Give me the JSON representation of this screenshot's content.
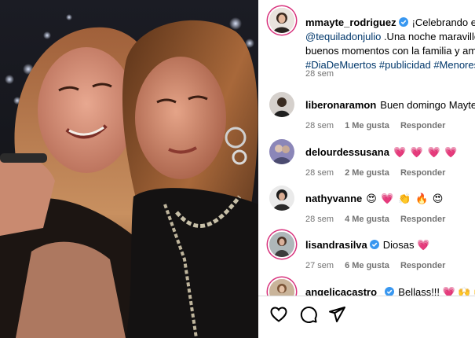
{
  "post": {
    "author": "mmayte_rodriguez",
    "caption_line1": "¡Celebrando el D",
    "caption_line2_mention": "@tequiladonjulio",
    "caption_line2_rest": " .Una noche maravillo",
    "caption_line3": "buenos momentos con la familia y ami",
    "caption_line4": "#DiaDeMuertos #publicidad #Menores",
    "time": "28 sem"
  },
  "comments": [
    {
      "user": "liberonaramon",
      "text": "Buen domingo Mayte",
      "time": "28 sem",
      "likes": "1 Me gusta",
      "reply": "Responder",
      "verified": false,
      "ring": false,
      "avatar_color": "#3a2c22"
    },
    {
      "user": "delourdessusana",
      "text": "💗 💗 💗 💗",
      "time": "28 sem",
      "likes": "2 Me gusta",
      "reply": "Responder",
      "verified": false,
      "ring": false,
      "avatar_color": "#6f6fa0"
    },
    {
      "user": "nathyvanne",
      "text": "😍 💗 👏 🔥 😍",
      "time": "28 sem",
      "likes": "4 Me gusta",
      "reply": "Responder",
      "verified": false,
      "ring": false,
      "avatar_color": "#2a2a2a"
    },
    {
      "user": "lisandrasilva",
      "text": "Diosas 💗",
      "time": "27 sem",
      "likes": "6 Me gusta",
      "reply": "Responder",
      "verified": true,
      "ring": true,
      "avatar_color": "#9aa3a6"
    },
    {
      "user": "angelicacastro_",
      "text": "Bellass!!! 💗 🙌 🙌 💗",
      "time": "",
      "likes": "",
      "reply": "",
      "verified": true,
      "ring": true,
      "avatar_color": "#b89a7a"
    }
  ],
  "actions": {
    "like": "heart-icon",
    "comment": "comment-icon",
    "share": "share-icon"
  },
  "colors": {
    "verified": "#3897f0",
    "ring": "#d8337d",
    "link": "#00376b",
    "meta": "#737373"
  }
}
